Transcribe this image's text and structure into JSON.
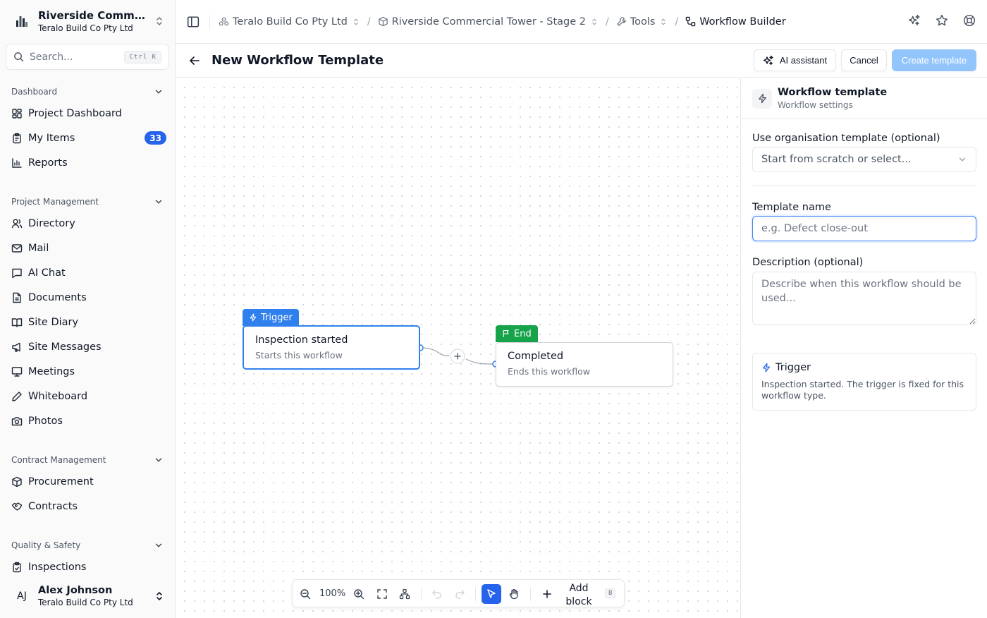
{
  "sidebar": {
    "project_name": "Riverside Commer...",
    "project_org": "Teralo Build Co Pty Ltd",
    "search_placeholder": "Search...",
    "search_shortcut": "Ctrl K",
    "sections": [
      {
        "label": "Dashboard",
        "items": [
          {
            "label": "Project Dashboard",
            "icon": "dashboard-icon"
          },
          {
            "label": "My Items",
            "icon": "clipboard-icon",
            "badge": "33"
          },
          {
            "label": "Reports",
            "icon": "reports-icon"
          }
        ]
      },
      {
        "label": "Project Management",
        "items": [
          {
            "label": "Directory",
            "icon": "users-icon"
          },
          {
            "label": "Mail",
            "icon": "mail-icon"
          },
          {
            "label": "AI Chat",
            "icon": "chat-icon"
          },
          {
            "label": "Documents",
            "icon": "document-icon"
          },
          {
            "label": "Site Diary",
            "icon": "book-icon"
          },
          {
            "label": "Site Messages",
            "icon": "megaphone-icon"
          },
          {
            "label": "Meetings",
            "icon": "presentation-icon"
          },
          {
            "label": "Whiteboard",
            "icon": "pen-icon"
          },
          {
            "label": "Photos",
            "icon": "camera-icon"
          }
        ]
      },
      {
        "label": "Contract Management",
        "items": [
          {
            "label": "Procurement",
            "icon": "package-icon"
          },
          {
            "label": "Contracts",
            "icon": "handshake-icon"
          }
        ]
      },
      {
        "label": "Quality & Safety",
        "items": [
          {
            "label": "Inspections",
            "icon": "clipboard-check-icon"
          }
        ]
      }
    ],
    "user": {
      "initials": "AJ",
      "name": "Alex Johnson",
      "org": "Teralo Build Co Pty Ltd"
    }
  },
  "topbar": {
    "breadcrumbs": [
      {
        "label": "Teralo Build Co Pty Ltd",
        "icon": "org-icon"
      },
      {
        "label": "Riverside Commercial Tower - Stage 2",
        "icon": "box-icon"
      },
      {
        "label": "Tools",
        "icon": "wrench-icon"
      },
      {
        "label": "Workflow Builder",
        "icon": "workflow-icon"
      }
    ]
  },
  "titlebar": {
    "title": "New Workflow Template",
    "ai_button": "AI assistant",
    "cancel_button": "Cancel",
    "create_button": "Create template"
  },
  "canvas": {
    "trigger_node": {
      "tag": "Trigger",
      "title": "Inspection started",
      "subtitle": "Starts this workflow"
    },
    "end_node": {
      "tag": "End",
      "title": "Completed",
      "subtitle": "Ends this workflow"
    },
    "toolbar": {
      "zoom": "100%",
      "add_block": "Add block",
      "add_block_shortcut": "B"
    }
  },
  "panel": {
    "title": "Workflow template",
    "subtitle": "Workflow settings",
    "org_template_label": "Use organisation template (optional)",
    "org_template_value": "Start from scratch or select...",
    "template_name_label": "Template name",
    "template_name_placeholder": "e.g. Defect close-out",
    "description_label": "Description (optional)",
    "description_placeholder": "Describe when this workflow should be used...",
    "trigger_card_title": "Trigger",
    "trigger_card_text": "Inspection started. The trigger is fixed for this workflow type."
  },
  "colors": {
    "accent": "#2563eb",
    "trigger": "#2f80ed",
    "end": "#16a34a",
    "create_disabled": "#93c5fd"
  }
}
